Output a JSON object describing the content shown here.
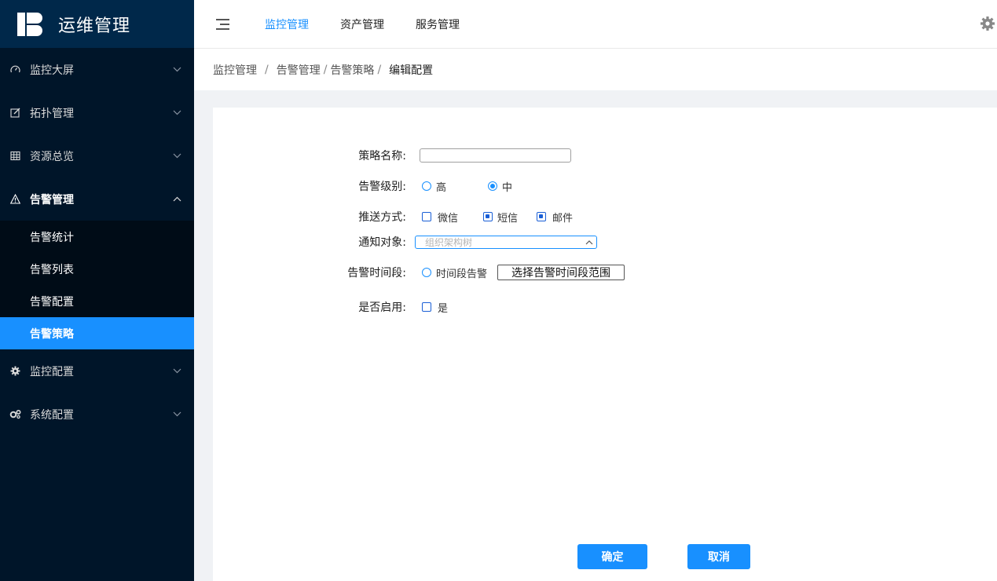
{
  "app": {
    "title": "运维管理",
    "logo_icon": "logo-icon"
  },
  "colors": {
    "sidebar": "#001529",
    "logo_bg": "#00284a",
    "primary": "#1890ff",
    "content_bg": "#f0f2f5"
  },
  "sidebar": {
    "items": [
      {
        "label": "监控大屏",
        "icon": "dashboard-icon"
      },
      {
        "label": "拓扑管理",
        "icon": "edit-icon"
      },
      {
        "label": "资源总览",
        "icon": "table-icon"
      },
      {
        "label": "告警管理",
        "icon": "warning-icon"
      },
      {
        "label": "监控配置",
        "icon": "gear-icon"
      },
      {
        "label": "系统配置",
        "icon": "gears-icon"
      }
    ],
    "alert_sub": [
      "告警统计",
      "告警列表",
      "告警配置",
      "告警策略"
    ]
  },
  "header": {
    "nav": [
      "监控管理",
      "资产管理",
      "服务管理"
    ]
  },
  "breadcrumb": {
    "items": [
      "监控管理",
      "告警管理",
      "告警策略"
    ],
    "sep": "/",
    "current": "编辑配置"
  },
  "form": {
    "name_label": "策略名称:",
    "name_value": "",
    "level_label": "告警级别:",
    "level_options": [
      "高",
      "中"
    ],
    "level_selected": "中",
    "push_label": "推送方式:",
    "push_options": [
      "微信",
      "短信",
      "邮件"
    ],
    "push_checked": [
      "短信",
      "邮件"
    ],
    "notify_label": "通知对象:",
    "notify_placeholder": "组织架构树",
    "time_label": "告警时间段:",
    "time_option": "时间段告警",
    "time_button": "选择告警时间段范围",
    "enable_label": "是否启用:",
    "enable_option": "是"
  },
  "actions": {
    "confirm": "确定",
    "cancel": "取消"
  }
}
